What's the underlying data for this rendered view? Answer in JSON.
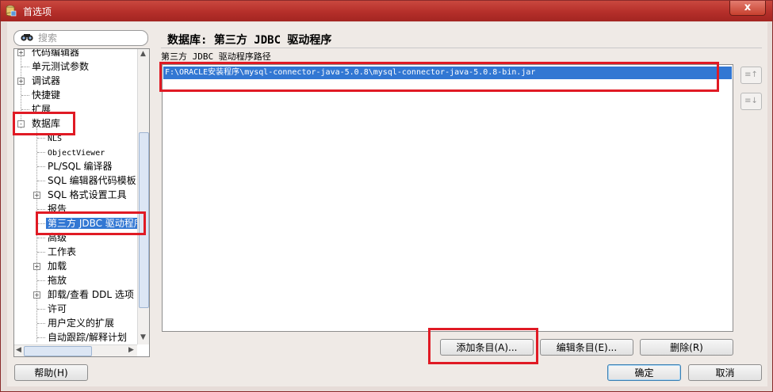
{
  "window": {
    "title": "首选项",
    "close_symbol": "x"
  },
  "search": {
    "placeholder": "搜索"
  },
  "tree": {
    "items": [
      {
        "label": "代码编辑器",
        "expander": "+"
      },
      {
        "label": "单元测试参数"
      },
      {
        "label": "调试器",
        "expander": "+"
      },
      {
        "label": "快捷键"
      },
      {
        "label": "扩展"
      },
      {
        "label": "数据库",
        "expander": "-"
      },
      {
        "label": "NLS"
      },
      {
        "label": "ObjectViewer"
      },
      {
        "label": "PL/SQL 编译器"
      },
      {
        "label": "SQL 编辑器代码模板"
      },
      {
        "label": "SQL 格式设置工具",
        "expander": "+"
      },
      {
        "label": "报告"
      },
      {
        "label": "第三方 JDBC 驱动程序",
        "selected": true
      },
      {
        "label": "高级"
      },
      {
        "label": "工作表"
      },
      {
        "label": "加载",
        "expander": "+"
      },
      {
        "label": "拖放"
      },
      {
        "label": "卸载/查看 DDL 选项",
        "expander": "+"
      },
      {
        "label": "许可"
      },
      {
        "label": "用户定义的扩展"
      },
      {
        "label": "自动跟踪/解释计划"
      }
    ]
  },
  "main": {
    "title": "数据库: 第三方 JDBC 驱动程序",
    "path_label": "第三方 JDBC 驱动程序路径",
    "paths": [
      "F:\\ORACLE安装程序\\mysql-connector-java-5.0.8\\mysql-connector-java-5.0.8-bin.jar"
    ],
    "move_up_symbol": "≡↑",
    "move_down_symbol": "≡↓"
  },
  "buttons": {
    "add": "添加条目(A)...",
    "edit": "编辑条目(E)...",
    "delete": "删除(R)",
    "help": "帮助(H)",
    "ok": "确定",
    "cancel": "取消"
  },
  "colors": {
    "selection": "#3277d3",
    "highlight_box": "#e01a24",
    "titlebar": "#b52f2a"
  }
}
